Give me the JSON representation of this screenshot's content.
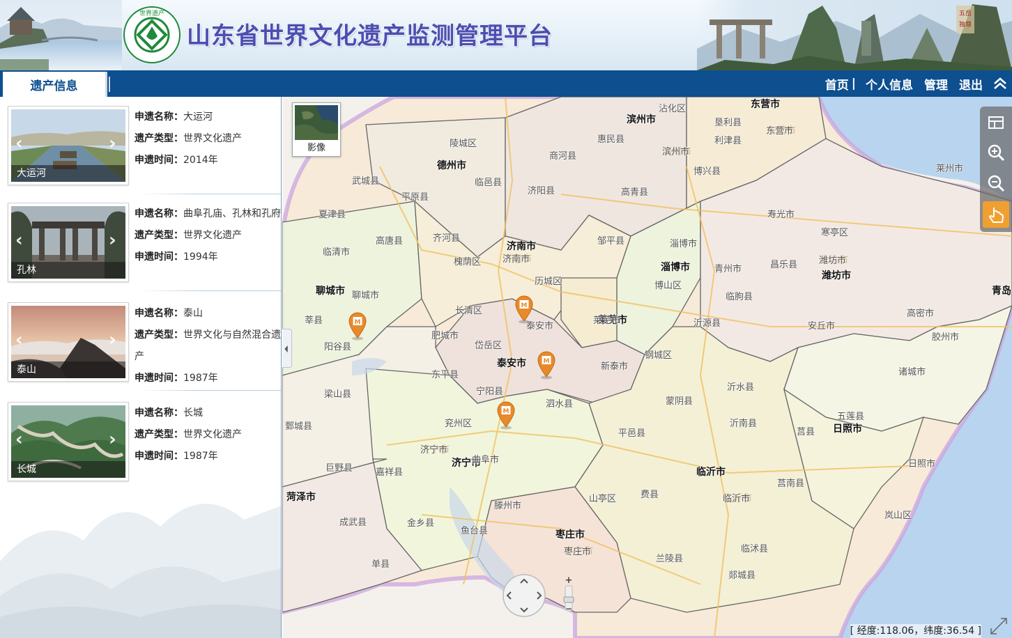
{
  "header": {
    "title": "山东省世界文化遗产监测管理平台",
    "logo_text": "世界遗产"
  },
  "nav": {
    "tab_label": "遗产信息",
    "links": [
      {
        "label": "首页",
        "sep": "|"
      },
      {
        "label": "个人信息"
      },
      {
        "label": "管理"
      },
      {
        "label": "退出"
      }
    ]
  },
  "heritage_items": [
    {
      "thumb_label": "大运河",
      "name_key": "申遗名称：",
      "name": "大运河",
      "type_key": "遗产类型：",
      "type": "世界文化遗产",
      "year_key": "申遗时间：",
      "year": "2014年"
    },
    {
      "thumb_label": "孔林",
      "name_key": "申遗名称：",
      "name": "曲阜孔庙、孔林和孔府",
      "type_key": "遗产类型：",
      "type": "世界文化遗产",
      "year_key": "申遗时间：",
      "year": "1994年"
    },
    {
      "thumb_label": "泰山",
      "name_key": "申遗名称：",
      "name": "泰山",
      "type_key": "遗产类型：",
      "type": "世界文化与自然混合遗产",
      "year_key": "申遗时间：",
      "year": "1987年"
    },
    {
      "thumb_label": "长城",
      "name_key": "申遗名称：",
      "name": "长城",
      "type_key": "遗产类型：",
      "type": "世界文化遗产",
      "year_key": "申遗时间：",
      "year": "1987年"
    }
  ],
  "map": {
    "basemap_label": "影像",
    "cities": [
      "东营市",
      "滨州市",
      "德州市",
      "济南市",
      "淄博市",
      "潍坊市",
      "青岛",
      "聊城市",
      "莱芜市",
      "泰安市",
      "日照市",
      "临沂市",
      "菏泽市",
      "济宁市",
      "枣庄市"
    ],
    "counties": [
      "沾化区",
      "垦利县",
      "东营市",
      "惠民县",
      "利津县",
      "商河县",
      "滨州市",
      "博兴县",
      "陵城区",
      "武城县",
      "临邑县",
      "平原县",
      "济阳县",
      "高青县",
      "莱州市",
      "寿光市",
      "寒亭区",
      "夏津县",
      "齐河县",
      "邹平县",
      "高唐县",
      "临清市",
      "槐荫区",
      "淄博市",
      "青州市",
      "昌乐县",
      "潍坊市",
      "济南市",
      "历城区",
      "博山区",
      "临朐县",
      "聊城市",
      "长清区",
      "莘县",
      "阳谷县",
      "泰安市",
      "莱芜市",
      "沂源县",
      "安丘市",
      "高密市",
      "胶州市",
      "肥城市",
      "岱岳区",
      "钢城区",
      "新泰市",
      "东平县",
      "诸城市",
      "宁阳县",
      "梁山县",
      "沂水县",
      "蒙阴县",
      "五莲县",
      "鄄城县",
      "兖州区",
      "泗水县",
      "平邑县",
      "沂南县",
      "莒县",
      "济宁市",
      "曲阜市",
      "巨野县",
      "嘉祥县",
      "日照市",
      "临沂市",
      "莒南县",
      "山亭区",
      "费县",
      "滕州市",
      "成武县",
      "金乡县",
      "鱼台县",
      "枣庄市",
      "岚山区",
      "临沭县",
      "兰陵县",
      "单县",
      "郯城县"
    ],
    "faint_labels": [
      "滨州市",
      "东营市",
      "潍坊市",
      "济南市",
      "济宁市",
      "临沂市",
      "枣庄市"
    ],
    "coords": "[ 经度:118.06，纬度:36.54 ]",
    "zoom_plus": "+",
    "zoom_minus": "−"
  },
  "colors": {
    "nav_bg": "#0d4f8f",
    "title": "#4c4fb0",
    "boundary": "#666666",
    "province_edge": "#c9a0e0",
    "sea": "#b9d4ee",
    "marker": "#e88a2a"
  },
  "icons": {
    "collapse": "double-chevron-up-icon",
    "layers": "layers-icon",
    "zoom_in": "zoom-in-icon",
    "zoom_out": "zoom-out-icon",
    "pan": "hand-icon",
    "marker": "heritage-marker-icon"
  }
}
